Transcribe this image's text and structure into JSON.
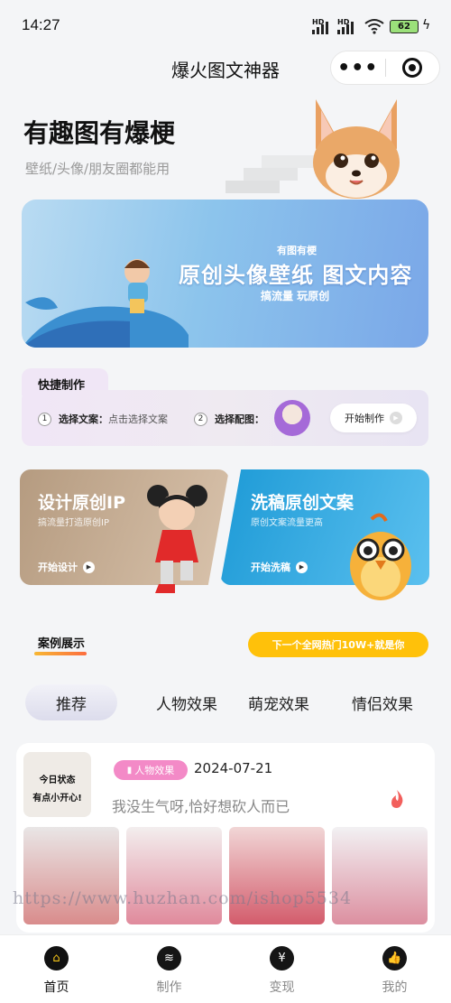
{
  "status": {
    "time": "14:27",
    "network1": "HD",
    "network2": "HD",
    "battery": "62"
  },
  "nav": {
    "title": "爆火图文神器"
  },
  "hero": {
    "title": "有趣图有爆梗",
    "subtitle": "壁纸/头像/朋友圈都能用"
  },
  "banner": {
    "small": "有图有梗",
    "title": "原创头像壁纸  图文内容",
    "sub": "搞流量  玩原创"
  },
  "quick": {
    "label": "快捷制作",
    "step1_num": "1",
    "step1_label": "选择文案：",
    "step1_hint": "点击选择文案",
    "step2_num": "2",
    "step2_label": "选择配图：",
    "start": "开始制作"
  },
  "features": [
    {
      "title": "设计原创IP",
      "sub": "搞流量打造原创IP",
      "button": "开始设计"
    },
    {
      "title": "洗稿原创文案",
      "sub": "原创文案流量更高",
      "button": "开始洗稿"
    }
  ],
  "cases": {
    "title": "案例展示",
    "hot": "下一个全网热门10W+就是你"
  },
  "tabs": [
    "推荐",
    "人物效果",
    "萌宠效果",
    "情侣效果"
  ],
  "item": {
    "thumb_line1": "今日状态",
    "thumb_line2": "有点小开心!",
    "tag": "人物效果",
    "date": "2024-07-21",
    "desc": "我没生气呀,恰好想砍人而已"
  },
  "watermark": "https://www.huzhan.com/ishop5534",
  "bottom": [
    {
      "label": "首页",
      "icon": "home-icon"
    },
    {
      "label": "制作",
      "icon": "layers-icon"
    },
    {
      "label": "变现",
      "icon": "money-icon"
    },
    {
      "label": "我的",
      "icon": "thumbs-up-icon"
    }
  ],
  "colors": {
    "accent": "#ffc10a",
    "tag": "#f38ac7",
    "banner": "#8cc4ec"
  }
}
